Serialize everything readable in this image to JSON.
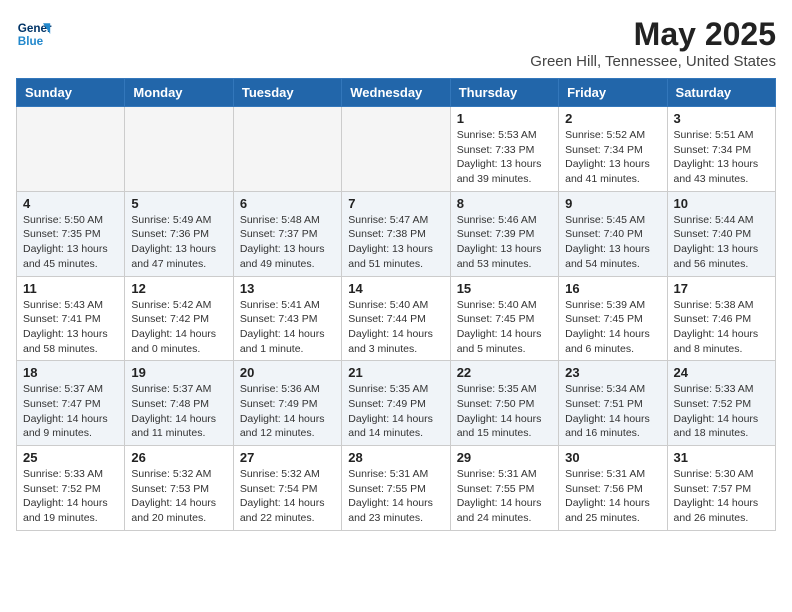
{
  "header": {
    "logo_line1": "General",
    "logo_line2": "Blue",
    "month_year": "May 2025",
    "location": "Green Hill, Tennessee, United States"
  },
  "weekdays": [
    "Sunday",
    "Monday",
    "Tuesday",
    "Wednesday",
    "Thursday",
    "Friday",
    "Saturday"
  ],
  "weeks": [
    [
      {
        "day": "",
        "detail": ""
      },
      {
        "day": "",
        "detail": ""
      },
      {
        "day": "",
        "detail": ""
      },
      {
        "day": "",
        "detail": ""
      },
      {
        "day": "1",
        "detail": "Sunrise: 5:53 AM\nSunset: 7:33 PM\nDaylight: 13 hours\nand 39 minutes."
      },
      {
        "day": "2",
        "detail": "Sunrise: 5:52 AM\nSunset: 7:34 PM\nDaylight: 13 hours\nand 41 minutes."
      },
      {
        "day": "3",
        "detail": "Sunrise: 5:51 AM\nSunset: 7:34 PM\nDaylight: 13 hours\nand 43 minutes."
      }
    ],
    [
      {
        "day": "4",
        "detail": "Sunrise: 5:50 AM\nSunset: 7:35 PM\nDaylight: 13 hours\nand 45 minutes."
      },
      {
        "day": "5",
        "detail": "Sunrise: 5:49 AM\nSunset: 7:36 PM\nDaylight: 13 hours\nand 47 minutes."
      },
      {
        "day": "6",
        "detail": "Sunrise: 5:48 AM\nSunset: 7:37 PM\nDaylight: 13 hours\nand 49 minutes."
      },
      {
        "day": "7",
        "detail": "Sunrise: 5:47 AM\nSunset: 7:38 PM\nDaylight: 13 hours\nand 51 minutes."
      },
      {
        "day": "8",
        "detail": "Sunrise: 5:46 AM\nSunset: 7:39 PM\nDaylight: 13 hours\nand 53 minutes."
      },
      {
        "day": "9",
        "detail": "Sunrise: 5:45 AM\nSunset: 7:40 PM\nDaylight: 13 hours\nand 54 minutes."
      },
      {
        "day": "10",
        "detail": "Sunrise: 5:44 AM\nSunset: 7:40 PM\nDaylight: 13 hours\nand 56 minutes."
      }
    ],
    [
      {
        "day": "11",
        "detail": "Sunrise: 5:43 AM\nSunset: 7:41 PM\nDaylight: 13 hours\nand 58 minutes."
      },
      {
        "day": "12",
        "detail": "Sunrise: 5:42 AM\nSunset: 7:42 PM\nDaylight: 14 hours\nand 0 minutes."
      },
      {
        "day": "13",
        "detail": "Sunrise: 5:41 AM\nSunset: 7:43 PM\nDaylight: 14 hours\nand 1 minute."
      },
      {
        "day": "14",
        "detail": "Sunrise: 5:40 AM\nSunset: 7:44 PM\nDaylight: 14 hours\nand 3 minutes."
      },
      {
        "day": "15",
        "detail": "Sunrise: 5:40 AM\nSunset: 7:45 PM\nDaylight: 14 hours\nand 5 minutes."
      },
      {
        "day": "16",
        "detail": "Sunrise: 5:39 AM\nSunset: 7:45 PM\nDaylight: 14 hours\nand 6 minutes."
      },
      {
        "day": "17",
        "detail": "Sunrise: 5:38 AM\nSunset: 7:46 PM\nDaylight: 14 hours\nand 8 minutes."
      }
    ],
    [
      {
        "day": "18",
        "detail": "Sunrise: 5:37 AM\nSunset: 7:47 PM\nDaylight: 14 hours\nand 9 minutes."
      },
      {
        "day": "19",
        "detail": "Sunrise: 5:37 AM\nSunset: 7:48 PM\nDaylight: 14 hours\nand 11 minutes."
      },
      {
        "day": "20",
        "detail": "Sunrise: 5:36 AM\nSunset: 7:49 PM\nDaylight: 14 hours\nand 12 minutes."
      },
      {
        "day": "21",
        "detail": "Sunrise: 5:35 AM\nSunset: 7:49 PM\nDaylight: 14 hours\nand 14 minutes."
      },
      {
        "day": "22",
        "detail": "Sunrise: 5:35 AM\nSunset: 7:50 PM\nDaylight: 14 hours\nand 15 minutes."
      },
      {
        "day": "23",
        "detail": "Sunrise: 5:34 AM\nSunset: 7:51 PM\nDaylight: 14 hours\nand 16 minutes."
      },
      {
        "day": "24",
        "detail": "Sunrise: 5:33 AM\nSunset: 7:52 PM\nDaylight: 14 hours\nand 18 minutes."
      }
    ],
    [
      {
        "day": "25",
        "detail": "Sunrise: 5:33 AM\nSunset: 7:52 PM\nDaylight: 14 hours\nand 19 minutes."
      },
      {
        "day": "26",
        "detail": "Sunrise: 5:32 AM\nSunset: 7:53 PM\nDaylight: 14 hours\nand 20 minutes."
      },
      {
        "day": "27",
        "detail": "Sunrise: 5:32 AM\nSunset: 7:54 PM\nDaylight: 14 hours\nand 22 minutes."
      },
      {
        "day": "28",
        "detail": "Sunrise: 5:31 AM\nSunset: 7:55 PM\nDaylight: 14 hours\nand 23 minutes."
      },
      {
        "day": "29",
        "detail": "Sunrise: 5:31 AM\nSunset: 7:55 PM\nDaylight: 14 hours\nand 24 minutes."
      },
      {
        "day": "30",
        "detail": "Sunrise: 5:31 AM\nSunset: 7:56 PM\nDaylight: 14 hours\nand 25 minutes."
      },
      {
        "day": "31",
        "detail": "Sunrise: 5:30 AM\nSunset: 7:57 PM\nDaylight: 14 hours\nand 26 minutes."
      }
    ]
  ]
}
